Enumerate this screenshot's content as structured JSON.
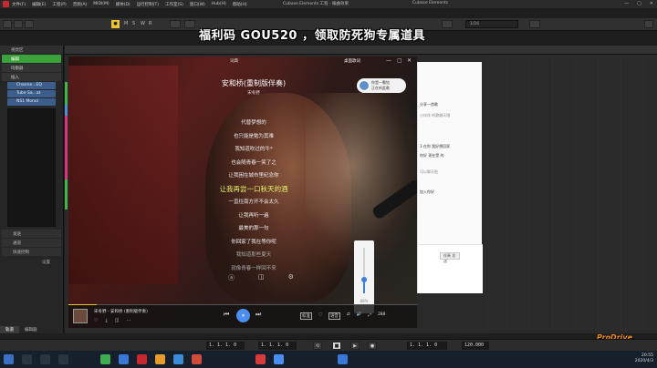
{
  "cubase": {
    "window_title": "Cubase Elements 工程 - 编曲效果",
    "window_title_right": "Cubase Elements",
    "menu": [
      "文件(F)",
      "编辑(E)",
      "工程(P)",
      "音频(A)",
      "MIDI(M)",
      "媒体(D)",
      "运行控制(T)",
      "工作室(S)",
      "窗口(W)",
      "Hub(H)",
      "帮助(H)"
    ],
    "window_controls": [
      "—",
      "▢",
      "✕"
    ],
    "toolbar_letters": [
      "M",
      "S",
      "W",
      "R"
    ],
    "toolbar_quantize": "1/16"
  },
  "overlay_banner": "福利码 GOU520 ，领取防死狗专属道具",
  "inspector": {
    "header": "视觉区",
    "track_name": "编辑",
    "rows": [
      "均衡器",
      "插入"
    ],
    "plugin_slots": [
      "Channe...EQ",
      "Tube Sa...at",
      "NS1 Monoi"
    ],
    "footer_rows": [
      "发送",
      "通道",
      "快速控制"
    ],
    "footer_label": "设置",
    "tabs": [
      "轨道",
      "编辑器"
    ]
  },
  "player": {
    "tab": "词典",
    "mode_label": "桌面歌词",
    "window_controls": [
      "—",
      "▢",
      "✕"
    ],
    "song_title": "安和桥(重制版伴奏)",
    "artist": "宋冬野",
    "lyrics": [
      "代替梦想的",
      "也只能是勉为其难",
      "我知道吹过的牛*",
      "也会随青春一笑了之",
      "让我困在城市里纪念你",
      "让我再尝一口秋天的酒",
      "一直往南方开不会太久",
      "让我再听一遍",
      "最美的那一句",
      "你回家了我在等你呢",
      "我知道那些夏天",
      "就像青春一样回不来"
    ],
    "active_lyric_index": 5,
    "lyric_tools": [
      "ⓐ",
      "◫",
      "⚙"
    ],
    "bubble": {
      "name": "你是一颗钻",
      "subtitle": "正在听此歌"
    },
    "volume": {
      "label": "88%",
      "level": 0.3
    },
    "now_playing": "宋冬野 - 安和桥 (重制版伴奏)",
    "bottom_icons": [
      "♡",
      "⤓",
      "◫",
      "⋯"
    ],
    "controls": {
      "prev": "⏮",
      "play": "⏸",
      "next": "⏭"
    },
    "right_controls": [
      "标准",
      "◌",
      "语音",
      "⇄",
      "🔊",
      "⤢",
      "288"
    ],
    "progress": 0.08
  },
  "chat": {
    "lines": [
      {
        "text": "分享一首歌",
        "grey": false
      },
      {
        "text": "小伙伴 听歌聊天哦",
        "grey": true
      },
      {
        "text": "3 在你 我好想回家",
        "grey": false
      },
      {
        "text": "你好 现在是 的",
        "grey": false
      },
      {
        "text": "可以聊天啦",
        "grey": true
      },
      {
        "text": "加入你好",
        "grey": false
      }
    ],
    "send_label": "伴奏 发送"
  },
  "transport": {
    "pos_left": "1. 1. 1. 0",
    "pos_right": "1. 1. 1. 0",
    "pos_main": "1. 1. 1. 0",
    "pos_main2": "1. 1. 1. 0",
    "tempo": "120.000",
    "buttons": [
      "⟲",
      "■",
      "▶",
      "●"
    ]
  },
  "watermark": "ProDrive",
  "taskbar": {
    "time": "20:55",
    "date": "2020/4/3"
  },
  "colors": {
    "cubase_red": "#c5282f",
    "accent_yellow": "#e8c531",
    "play_blue": "#4a8ef0",
    "active_lyric": "#e9f26a"
  }
}
